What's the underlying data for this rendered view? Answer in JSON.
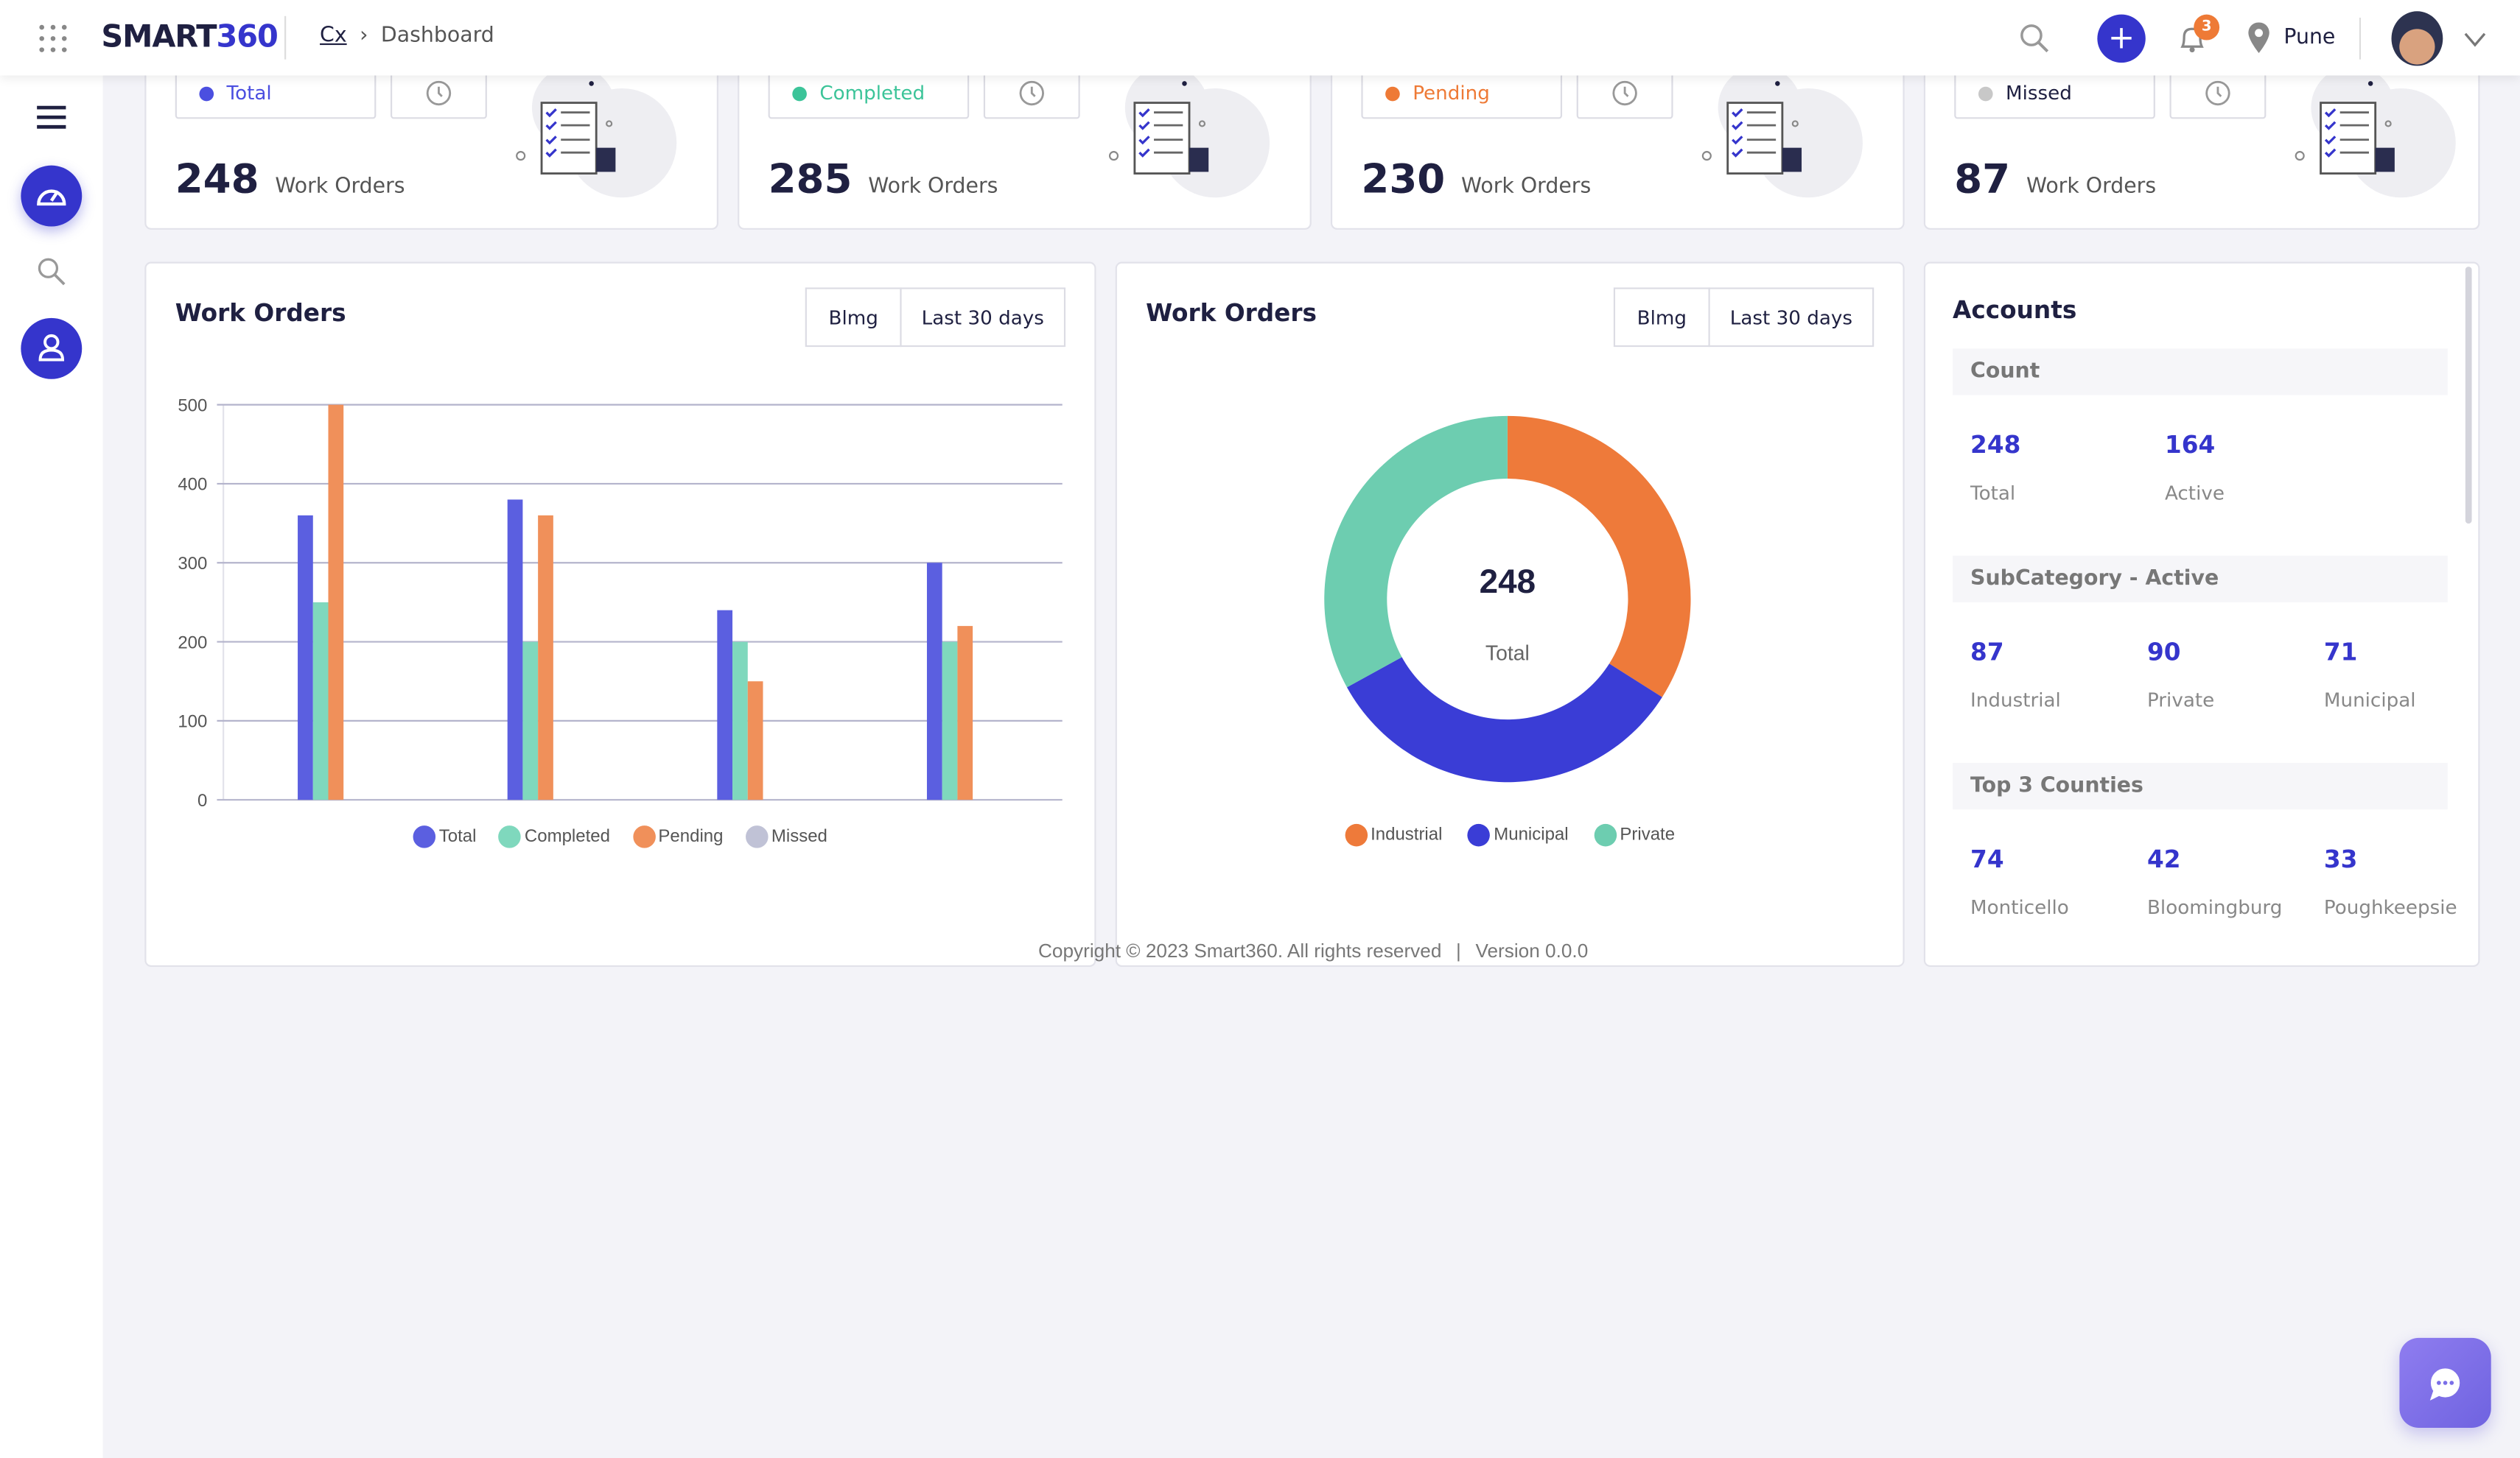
{
  "header": {
    "brand_a": "SMART",
    "brand_b": "360",
    "breadcrumb": [
      "Cx",
      "Dashboard"
    ],
    "notifications": "3",
    "location": "Pune",
    "icons": [
      "apps-grid-icon",
      "search-icon",
      "plus-icon",
      "bell-icon",
      "location-pin-icon",
      "avatar",
      "chevron-down-icon"
    ]
  },
  "sidebar": {
    "icons": [
      "menu-icon",
      "dashboard-gauge-icon",
      "search-icon",
      "user-icon"
    ]
  },
  "stats": [
    {
      "label": "Total",
      "value": "248",
      "unit": "Work Orders",
      "color": "#4b4fe0"
    },
    {
      "label": "Completed",
      "value": "285",
      "unit": "Work Orders",
      "color": "#3cc499"
    },
    {
      "label": "Pending",
      "value": "230",
      "unit": "Work Orders",
      "color": "#ee7a36"
    },
    {
      "label": "Missed",
      "value": "87",
      "unit": "Work Orders",
      "color": "#c8c8c8"
    }
  ],
  "bar_card": {
    "title": "Work Orders",
    "filter": "Blmg",
    "range": "Last 30 days"
  },
  "donut_card": {
    "title": "Work Orders",
    "filter": "Blmg",
    "range": "Last 30 days",
    "center_value": "248",
    "center_label": "Total"
  },
  "chart_data": [
    {
      "type": "bar",
      "ylim": [
        0,
        500
      ],
      "yticks": [
        "0",
        "100",
        "200",
        "300",
        "400",
        "500"
      ],
      "grid": true,
      "legend": "bottom",
      "series": [
        {
          "name": "Total",
          "color": "#5b5fe0",
          "values": [
            360,
            380,
            240,
            300
          ]
        },
        {
          "name": "Completed",
          "color": "#7fd8bd",
          "values": [
            250,
            200,
            200,
            200
          ]
        },
        {
          "name": "Pending",
          "color": "#f0905a",
          "values": [
            500,
            360,
            150,
            220
          ]
        },
        {
          "name": "Missed",
          "color": "#c0c2d6",
          "values": [
            0,
            0,
            0,
            0
          ]
        }
      ]
    },
    {
      "type": "pie",
      "donut": true,
      "legend": "bottom",
      "unit": "percent",
      "series": [
        {
          "name": "Industrial",
          "color": "#ee7a3a",
          "value": 34
        },
        {
          "name": "Municipal",
          "color": "#3a3dd6",
          "value": 33
        },
        {
          "name": "Private",
          "color": "#6dcdb0",
          "value": 33
        }
      ]
    }
  ],
  "accounts": {
    "title": "Accounts",
    "sections": [
      {
        "title": "Count",
        "items": [
          {
            "value": "248",
            "label": "Total"
          },
          {
            "value": "164",
            "label": "Active"
          }
        ]
      },
      {
        "title": "SubCategory - Active",
        "items": [
          {
            "value": "87",
            "label": "Industrial"
          },
          {
            "value": "90",
            "label": "Private"
          },
          {
            "value": "71",
            "label": "Municipal"
          }
        ]
      },
      {
        "title": "Top 3 Counties",
        "items": [
          {
            "value": "74",
            "label": "Monticello"
          },
          {
            "value": "42",
            "label": "Bloomingburg"
          },
          {
            "value": "33",
            "label": "Poughkeepsie"
          }
        ]
      }
    ]
  },
  "footer": {
    "copyright": "Copyright © 2023 Smart360. All rights reserved",
    "version": "Version 0.0.0",
    "sep": "|"
  }
}
